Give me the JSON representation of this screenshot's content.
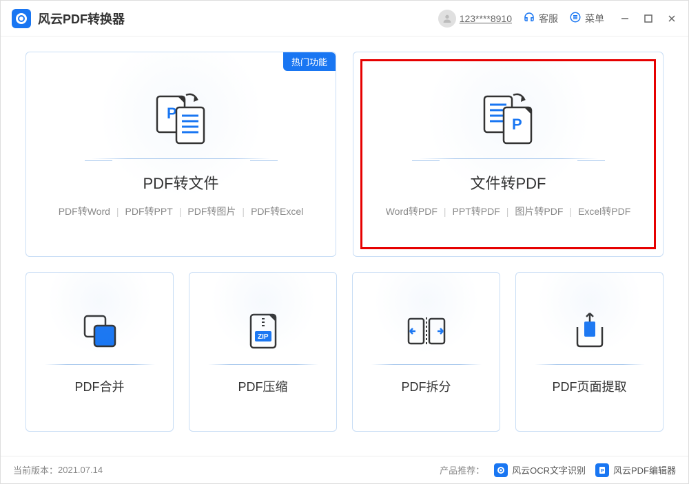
{
  "app": {
    "title": "风云PDF转换器",
    "user_id": "123****8910",
    "support_label": "客服",
    "menu_label": "菜单"
  },
  "cards": {
    "large": [
      {
        "title": "PDF转文件",
        "hot_badge": "热门功能",
        "highlighted": false,
        "subs": [
          "PDF转Word",
          "PDF转PPT",
          "PDF转图片",
          "PDF转Excel"
        ]
      },
      {
        "title": "文件转PDF",
        "hot_badge": null,
        "highlighted": true,
        "subs": [
          "Word转PDF",
          "PPT转PDF",
          "图片转PDF",
          "Excel转PDF"
        ]
      }
    ],
    "small": [
      {
        "title": "PDF合并",
        "icon": "merge"
      },
      {
        "title": "PDF压缩",
        "icon": "zip"
      },
      {
        "title": "PDF拆分",
        "icon": "split"
      },
      {
        "title": "PDF页面提取",
        "icon": "extract"
      }
    ]
  },
  "footer": {
    "version_label": "当前版本：",
    "version": "2021.07.14",
    "promo_label": "产品推荐：",
    "promos": [
      {
        "name": "风云OCR文字识别"
      },
      {
        "name": "风云PDF编辑器"
      }
    ]
  },
  "colors": {
    "primary": "#1976f2",
    "border": "#c8ddf5",
    "highlight": "#e60000"
  }
}
